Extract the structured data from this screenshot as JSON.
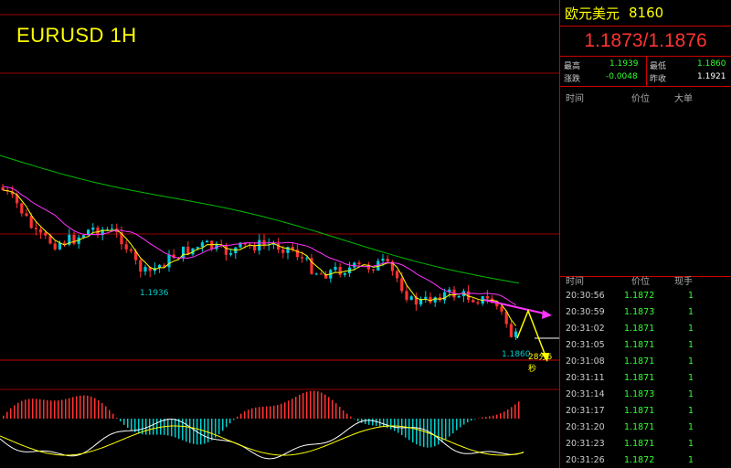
{
  "chart": {
    "symbol": "EURUSD 1H",
    "high_marker": "1.1936",
    "low_marker": "1.1860",
    "countdown": "28分6秒",
    "colors": {
      "bull": "#00ccdd",
      "bear": "#ff3333",
      "ma_fast": "#ffff00",
      "ma_mid": "#ff33ff",
      "ma_slow": "#00bb00",
      "kdj_k": "#ffffff",
      "kdj_d": "#ffff00",
      "hist_pos": "#ff3333",
      "hist_neg": "#00cccc",
      "grid": "#990000"
    }
  },
  "panel": {
    "name": "欧元美元",
    "code": "8160",
    "quote": "1.1873/1.1876",
    "stats": {
      "high_label": "最高",
      "high_value": "1.1939",
      "low_label": "最低",
      "low_value": "1.1860",
      "change_label": "涨跌",
      "change_value": "-0.0048",
      "prev_close_label": "昨收",
      "prev_close_value": "1.1921"
    },
    "upper_headers": {
      "time": "时间",
      "price": "价位",
      "big": "大单"
    },
    "lower_headers": {
      "time": "时间",
      "price": "价位",
      "volume": "现手"
    },
    "ticks": [
      {
        "time": "20:30:56",
        "price": "1.1872",
        "vol": "1"
      },
      {
        "time": "20:30:59",
        "price": "1.1873",
        "vol": "1"
      },
      {
        "time": "20:31:02",
        "price": "1.1871",
        "vol": "1"
      },
      {
        "time": "20:31:05",
        "price": "1.1871",
        "vol": "1"
      },
      {
        "time": "20:31:08",
        "price": "1.1871",
        "vol": "1"
      },
      {
        "time": "20:31:11",
        "price": "1.1871",
        "vol": "1"
      },
      {
        "time": "20:31:14",
        "price": "1.1873",
        "vol": "1"
      },
      {
        "time": "20:31:17",
        "price": "1.1871",
        "vol": "1"
      },
      {
        "time": "20:31:20",
        "price": "1.1871",
        "vol": "1"
      },
      {
        "time": "20:31:23",
        "price": "1.1871",
        "vol": "1"
      },
      {
        "time": "20:31:26",
        "price": "1.1872",
        "vol": "1"
      }
    ]
  }
}
